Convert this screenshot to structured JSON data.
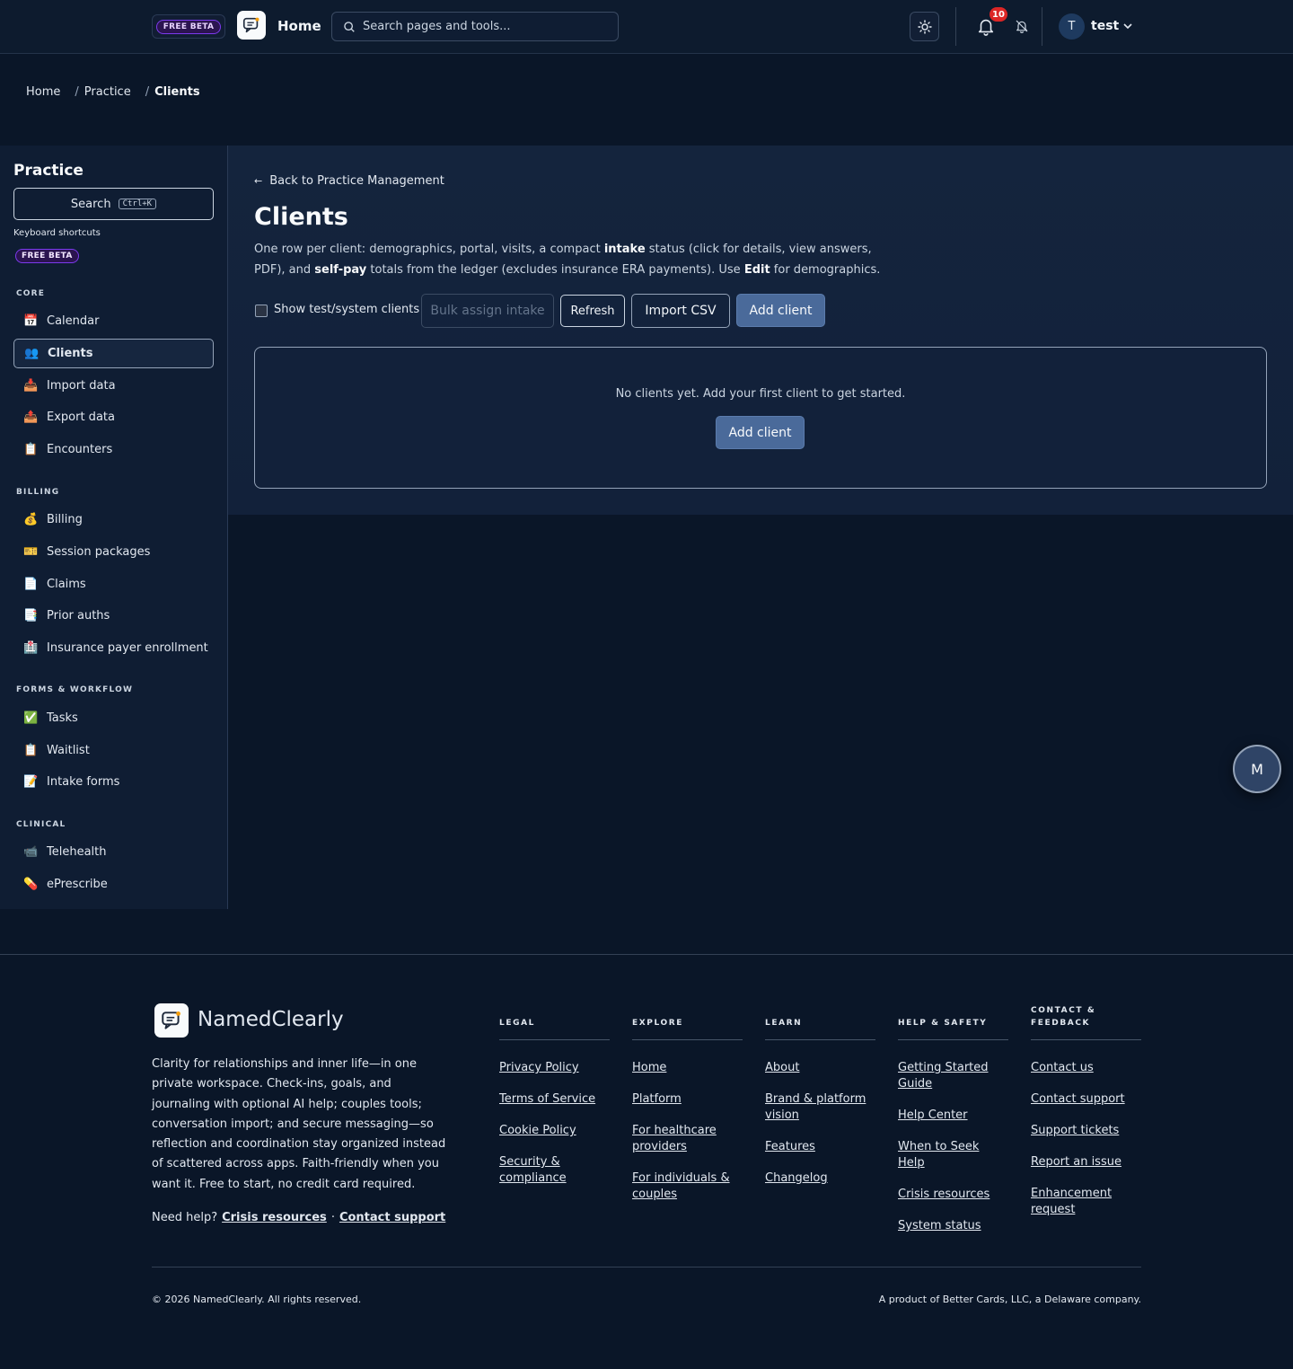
{
  "topbar": {
    "beta_badge": "FREE BETA",
    "home_label": "Home",
    "search_placeholder": "Search pages and tools...",
    "notification_count": "10",
    "avatar_initial": "T",
    "user_name": "test"
  },
  "breadcrumb": {
    "home": "Home",
    "sep": "/",
    "practice": "Practice",
    "current": "Clients"
  },
  "sidebar": {
    "title": "Practice",
    "search_label": "Search",
    "search_kbd": "Ctrl+K",
    "shortcuts_label": "Keyboard shortcuts",
    "beta_badge": "FREE BETA",
    "sections": {
      "core": "CORE",
      "billing": "BILLING",
      "forms": "FORMS & WORKFLOW",
      "clinical": "CLINICAL"
    },
    "items": [
      {
        "icon": "📅",
        "label": "Calendar"
      },
      {
        "icon": "👥",
        "label": "Clients"
      },
      {
        "icon": "📥",
        "label": "Import data"
      },
      {
        "icon": "📤",
        "label": "Export data"
      },
      {
        "icon": "📋",
        "label": "Encounters"
      },
      {
        "icon": "💰",
        "label": "Billing"
      },
      {
        "icon": "🎫",
        "label": "Session packages"
      },
      {
        "icon": "📄",
        "label": "Claims"
      },
      {
        "icon": "📑",
        "label": "Prior auths"
      },
      {
        "icon": "🏥",
        "label": "Insurance payer enrollment"
      },
      {
        "icon": "✅",
        "label": "Tasks"
      },
      {
        "icon": "📋",
        "label": "Waitlist"
      },
      {
        "icon": "📝",
        "label": "Intake forms"
      },
      {
        "icon": "📹",
        "label": "Telehealth"
      },
      {
        "icon": "💊",
        "label": "ePrescribe"
      }
    ]
  },
  "main": {
    "back_arrow": "←",
    "back_label": "Back to Practice Management",
    "title": "Clients",
    "desc": {
      "p1": "One row per client: demographics, portal, visits, a compact ",
      "b1": "intake",
      "p2": " status (click for details, view answers, PDF), and ",
      "b2": "self-pay",
      "p3": " totals from the ledger (excludes insurance ERA payments). Use ",
      "b3": "Edit",
      "p4": " for demographics."
    },
    "show_test_label": "Show test/system clients",
    "bulk_label": "Bulk assign intake",
    "refresh_label": "Refresh",
    "import_label": "Import CSV",
    "add_label": "Add client",
    "empty_message": "No clients yet. Add your first client to get started.",
    "empty_add_label": "Add client"
  },
  "floating_button": "M",
  "footer": {
    "brand": "NamedClearly",
    "blurb": "Clarity for relationships and inner life—in one private workspace. Check-ins, goals, and journaling with optional AI help; couples tools; conversation import; and secure messaging—so reflection and coordination stay organized instead of scattered across apps. Faith-friendly when you want it. Free to start, no credit card required.",
    "help_prefix": "Need help?",
    "help_crisis": "Crisis resources",
    "help_dot": "·",
    "help_contact": "Contact support",
    "columns": {
      "legal": {
        "title": "LEGAL",
        "links": [
          "Privacy Policy",
          "Terms of Service",
          "Cookie Policy",
          "Security & compliance"
        ]
      },
      "explore": {
        "title": "EXPLORE",
        "links": [
          "Home",
          "Platform",
          "For healthcare providers",
          "For individuals & couples"
        ]
      },
      "learn": {
        "title": "LEARN",
        "links": [
          "About",
          "Brand & platform vision",
          "Features",
          "Changelog"
        ]
      },
      "help": {
        "title": "HELP & SAFETY",
        "links": [
          "Getting Started Guide",
          "Help Center",
          "When to Seek Help",
          "Crisis resources",
          "System status"
        ]
      },
      "contact": {
        "title": "CONTACT & FEEDBACK",
        "links": [
          "Contact us",
          "Contact support",
          "Support tickets",
          "Report an issue",
          "Enhancement request"
        ]
      }
    },
    "copyright": "© 2026 NamedClearly. All rights reserved.",
    "product": "A product of Better Cards, LLC, a Delaware company."
  },
  "colors": {
    "background": "#0a1628",
    "panel": "#14243d",
    "primary_button": "#4a6a9a",
    "beta_purple": "#7c3aed",
    "notification_red": "#dc2626"
  }
}
